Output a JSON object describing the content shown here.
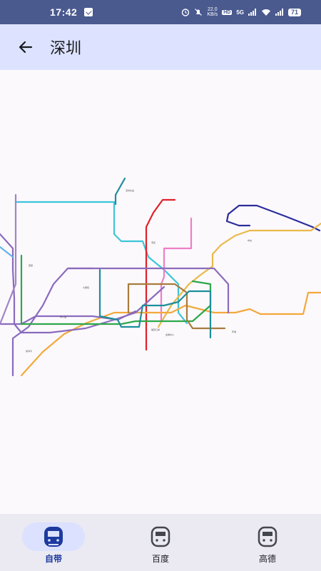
{
  "status": {
    "time": "17:42",
    "speed_value": "22.0",
    "speed_unit": "KB/s",
    "hd": "HD",
    "network": "5G",
    "battery": "71"
  },
  "header": {
    "title": "深圳",
    "back_icon": "arrow-left-icon"
  },
  "map": {
    "labels": [
      "深圳北站",
      "福田口岸",
      "前海湾",
      "车公庙",
      "会展中心",
      "布吉",
      "西丽",
      "大剧院",
      "老街",
      "罗湖"
    ]
  },
  "bottom_nav": {
    "items": [
      {
        "label": "自带",
        "icon": "metro-icon",
        "active": true
      },
      {
        "label": "百度",
        "icon": "metro-icon",
        "active": false
      },
      {
        "label": "高德",
        "icon": "metro-icon",
        "active": false
      }
    ]
  },
  "colors": {
    "accent": "#1d3a9e",
    "app_bar": "#dde3ff",
    "status_bar": "#4a5a8f"
  }
}
